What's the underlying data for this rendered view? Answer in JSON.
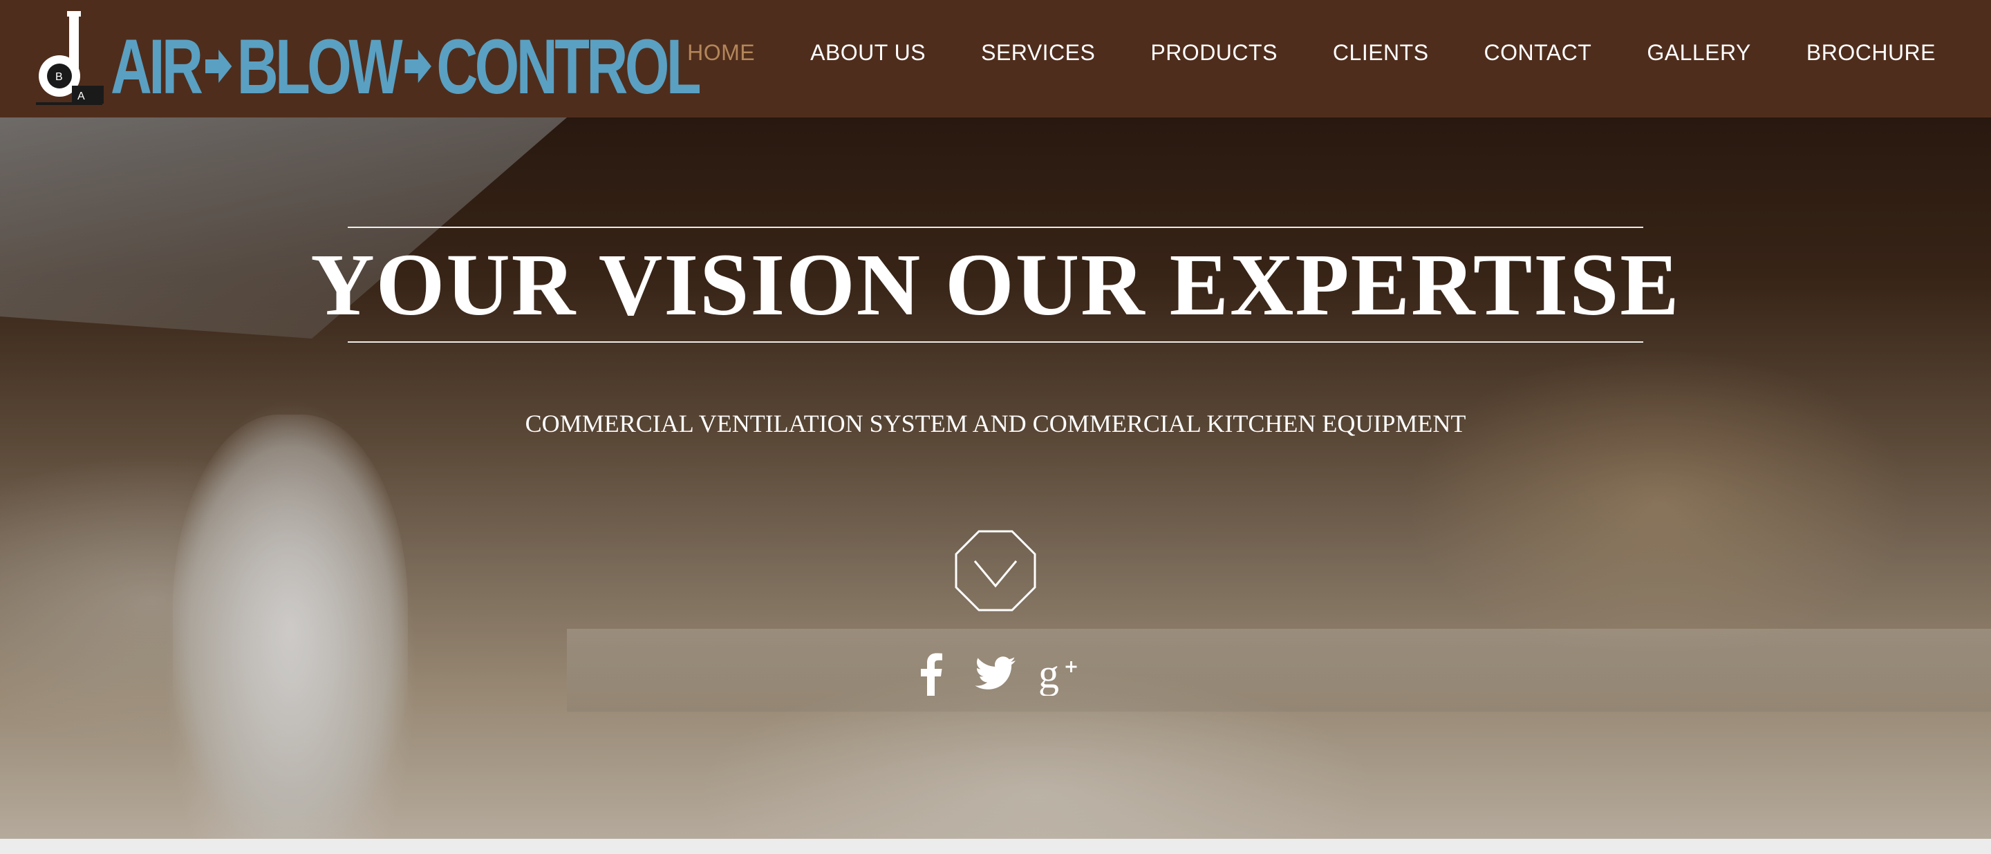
{
  "header": {
    "logo": {
      "mark_letter": "d",
      "mark_small_left": "B",
      "mark_small_right": "A",
      "words": [
        "AIR",
        "BLOW",
        "CONTROL"
      ]
    },
    "nav": [
      {
        "label": "HOME",
        "active": true
      },
      {
        "label": "ABOUT US",
        "active": false
      },
      {
        "label": "SERVICES",
        "active": false
      },
      {
        "label": "PRODUCTS",
        "active": false
      },
      {
        "label": "CLIENTS",
        "active": false
      },
      {
        "label": "CONTACT",
        "active": false
      },
      {
        "label": "GALLERY",
        "active": false
      },
      {
        "label": "BROCHURE",
        "active": false
      }
    ]
  },
  "hero": {
    "headline": "YOUR VISION OUR EXPERTISE",
    "subheadline": "COMMERCIAL VENTILATION SYSTEM AND COMMERCIAL KITCHEN EQUIPMENT",
    "scroll_icon": "chevron-down-octagon-icon",
    "social": [
      {
        "name": "facebook",
        "icon": "facebook-icon"
      },
      {
        "name": "twitter",
        "icon": "twitter-icon"
      },
      {
        "name": "google-plus",
        "icon": "google-plus-icon"
      }
    ]
  },
  "colors": {
    "header_bg": "#4f2d1c",
    "nav_text": "#ffffff",
    "nav_active": "#b3875a",
    "logo_blue": "#5aa0c2"
  }
}
